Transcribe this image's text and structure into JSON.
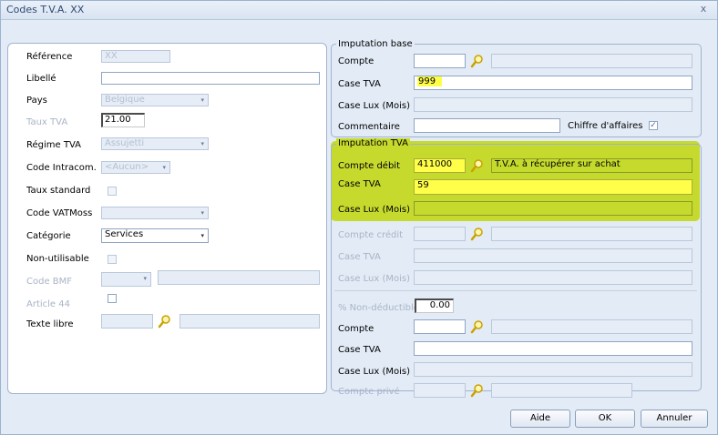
{
  "window": {
    "title": "Codes T.V.A. XX",
    "close_label": "x"
  },
  "left": {
    "reference": {
      "label": "Référence",
      "value": "XX"
    },
    "libelle": {
      "label": "Libellé",
      "value": ""
    },
    "pays": {
      "label": "Pays",
      "value": "Belgique"
    },
    "taux_tva": {
      "label": "Taux TVA",
      "value": "21.00"
    },
    "regime_tva": {
      "label": "Régime TVA",
      "value": "Assujetti"
    },
    "code_intracom": {
      "label": "Code Intracom.",
      "value": "<Aucun>"
    },
    "taux_standard": {
      "label": "Taux standard"
    },
    "code_vatmoss": {
      "label": "Code VATMoss",
      "value": ""
    },
    "categorie": {
      "label": "Catégorie",
      "value": "Services"
    },
    "non_utilisable": {
      "label": "Non-utilisable"
    },
    "code_bmf": {
      "label": "Code BMF",
      "value": ""
    },
    "article_44": {
      "label": "Article 44"
    },
    "texte_libre": {
      "label": "Texte libre",
      "value": ""
    }
  },
  "imputation_base": {
    "title": "Imputation base",
    "compte": {
      "label": "Compte",
      "value": ""
    },
    "case_tva": {
      "label": "Case TVA",
      "value": "999"
    },
    "case_lux": {
      "label": "Case Lux (Mois)",
      "value": ""
    },
    "commentaire": {
      "label": "Commentaire",
      "value": ""
    },
    "chiffre_affaires": {
      "label": "Chiffre d'affaires",
      "checked": true
    }
  },
  "imputation_tva": {
    "title": "Imputation TVA",
    "compte_debit": {
      "label": "Compte débit",
      "value": "411000",
      "description": "T.V.A. à récupérer sur achat"
    },
    "case_tva": {
      "label": "Case TVA",
      "value": "59"
    },
    "case_lux": {
      "label": "Case Lux (Mois)",
      "value": ""
    },
    "compte_credit": {
      "label": "Compte crédit",
      "value": ""
    },
    "case_tva_credit": {
      "label": "Case TVA",
      "value": ""
    },
    "case_lux_credit": {
      "label": "Case Lux (Mois)",
      "value": ""
    }
  },
  "non_deductible": {
    "pct": {
      "label": "% Non-déductible",
      "value": "0.00"
    },
    "compte": {
      "label": "Compte",
      "value": ""
    },
    "case_tva": {
      "label": "Case TVA",
      "value": ""
    },
    "case_lux": {
      "label": "Case Lux (Mois)",
      "value": ""
    },
    "compte_prive": {
      "label": "Compte privé",
      "value": ""
    }
  },
  "buttons": {
    "aide": "Aide",
    "ok": "OK",
    "annuler": "Annuler"
  },
  "colors": {
    "highlight_yellow": "#ffff4a",
    "section_green": "#c6da2e",
    "title_blue": "#2f4a74"
  },
  "icons": [
    "search-icon",
    "close-icon",
    "chevron-down-icon",
    "checkbox-icon"
  ]
}
